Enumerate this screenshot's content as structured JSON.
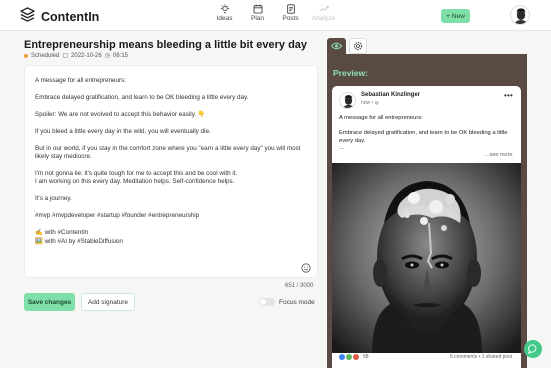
{
  "app": {
    "name": "ContentIn",
    "icons": [
      "logo-icon",
      "ideas-icon",
      "plan-icon",
      "posts-icon",
      "analyze-icon",
      "plus-icon",
      "eye-icon",
      "gear-icon",
      "emoji-icon",
      "chat-icon",
      "globe-icon",
      "more-icon"
    ]
  },
  "nav": {
    "items": [
      {
        "label": "Ideas",
        "enabled": true
      },
      {
        "label": "Plan",
        "enabled": true
      },
      {
        "label": "Posts",
        "enabled": true
      },
      {
        "label": "Analyze",
        "enabled": false
      }
    ],
    "new_label": "New"
  },
  "post": {
    "title": "Entrepreneurship means bleeding a little bit every day",
    "status": "Scheduled",
    "date": "2022-10-26",
    "time": "06:15",
    "body": [
      "A message for all entrepreneurs:",
      "Embrace delayed gratification, and learn to be OK bleeding a little every day.",
      "Spoiler: We are not evolved to accept this behavior easily. 👇",
      "If you bleed a little every day in the wild, you will eventually die.",
      "But in our world, if you stay in the comfort zone where you \"earn a little every day\" you will most likely stay mediocre.",
      "I'm not gonna lie: it's quite tough for me to accept this and be cool with it.",
      "I am working on this every day. Meditation helps. Self-confidence helps.",
      "It's a journey.",
      "#mvp #mvpdeveloper #startup #founder #entrepreneurship",
      "✍️ with #ContentIn",
      "🖼️ with #AI by #StableDiffusion"
    ],
    "char_count": "651 / 3000"
  },
  "actions": {
    "save_label": "Save changes",
    "signature_label": "Add signature",
    "focus_label": "Focus mode",
    "focus_enabled": false
  },
  "preview": {
    "label": "Preview:",
    "author": "Sebastian Kinzlinger",
    "time": "now •",
    "text": [
      "A message for all entrepreneurs:",
      "Embrace delayed gratification, and learn to be OK bleeding a little every day.",
      "..."
    ],
    "see_more": "...see more",
    "reaction_count": "58",
    "stats": "5 comments • 1 shared post"
  },
  "colors": {
    "accent_green": "#7ee0a8",
    "panel_brown": "#5a4a44",
    "preview_label_green": "#8fe0b0",
    "scheduled_orange": "#f3a23a",
    "chat_green": "#43c98a"
  }
}
